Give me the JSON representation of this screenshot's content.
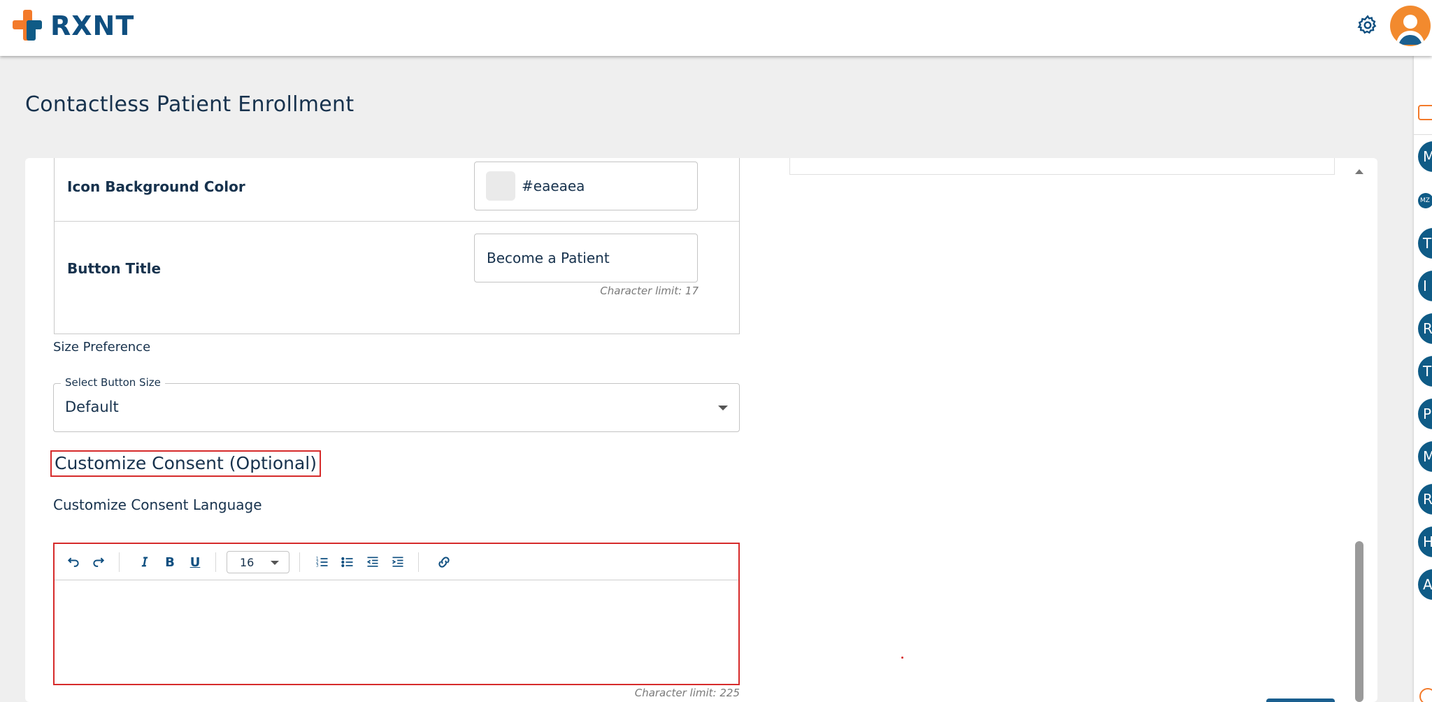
{
  "header": {
    "logo_text": "RXNT",
    "settings_icon": "gear-icon",
    "avatar_icon": "user-avatar-icon"
  },
  "page": {
    "title": "Contactless Patient Enrollment"
  },
  "settings": {
    "icon_bg_label": "Icon Background Color",
    "icon_bg_value": "#eaeaea",
    "icon_bg_swatch_color": "#eaeaea",
    "button_title_label": "Button Title",
    "button_title_value": "Become a Patient",
    "button_title_char_limit": "Character limit: 17"
  },
  "size": {
    "section_label": "Size Preference",
    "select_label": "Select Button Size",
    "select_value": "Default"
  },
  "consent": {
    "heading": "Customize Consent (Optional)",
    "language_label": "Customize Consent Language",
    "char_limit": "Character limit: 225",
    "editor": {
      "font_size": "16",
      "tools": [
        "undo-icon",
        "redo-icon",
        "italic-icon",
        "bold-icon",
        "underline-icon",
        "numbered-list-icon",
        "bulleted-list-icon",
        "outdent-icon",
        "indent-icon",
        "link-icon"
      ]
    }
  },
  "rail": {
    "avatars": [
      "M",
      "MZ",
      "T",
      "I",
      "R",
      "T",
      "P",
      "M",
      "R",
      "H",
      "A"
    ]
  },
  "colors": {
    "brand_blue": "#0f4f80",
    "brand_orange": "#f37a2a",
    "highlight_red": "#d62b2b"
  }
}
